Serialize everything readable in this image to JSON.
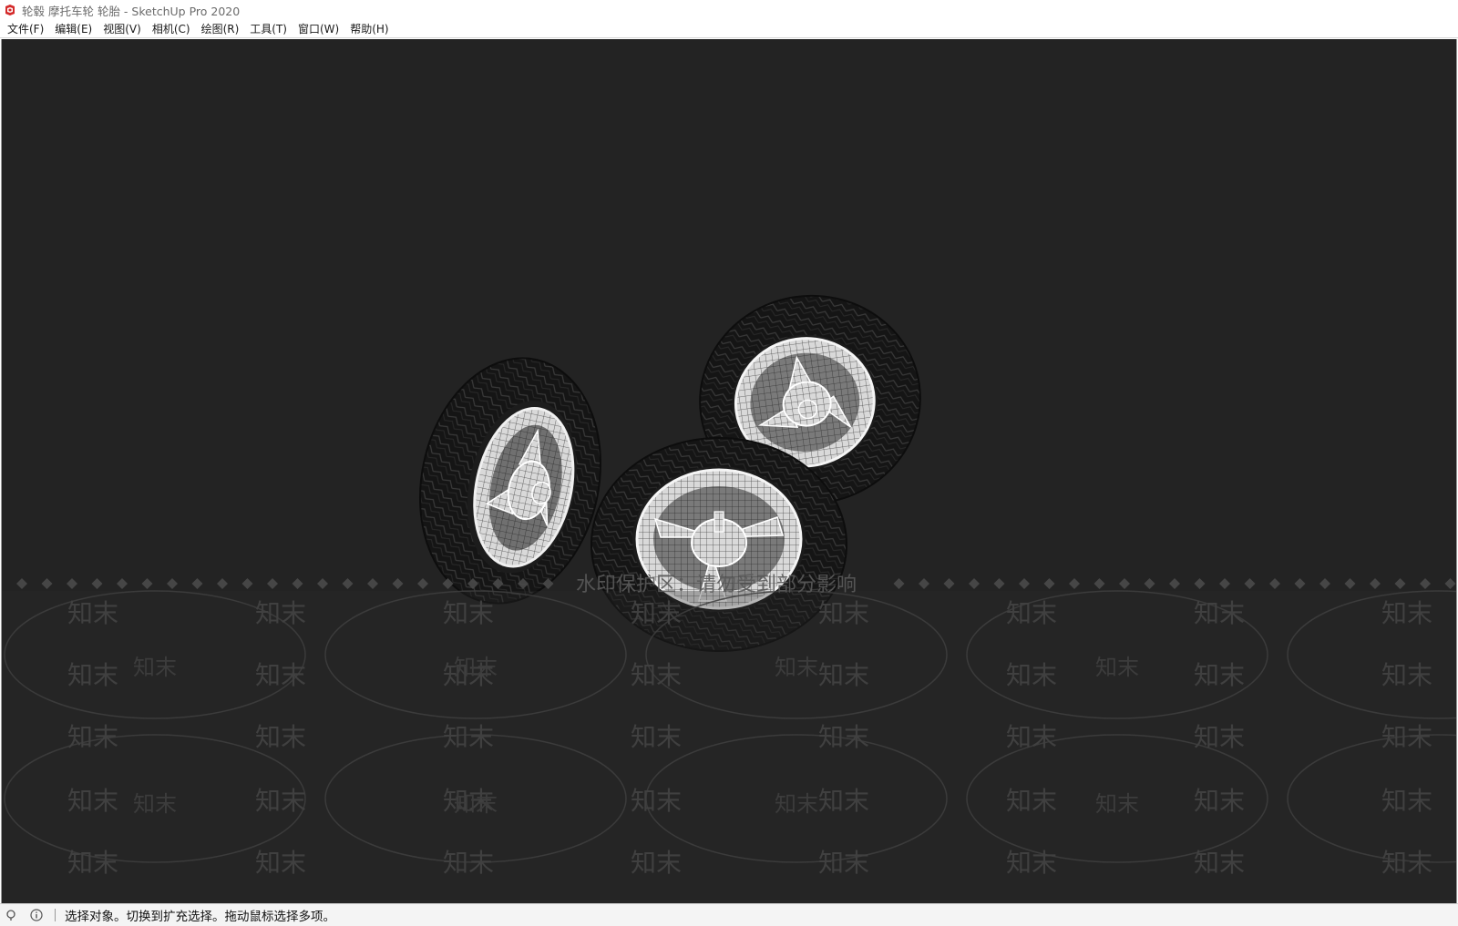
{
  "window": {
    "title": "轮毂 摩托车轮 轮胎 - SketchUp Pro 2020",
    "app_icon": "sketchup-logo-icon"
  },
  "menubar": {
    "items": [
      {
        "label": "文件(F)"
      },
      {
        "label": "编辑(E)"
      },
      {
        "label": "视图(V)"
      },
      {
        "label": "相机(C)"
      },
      {
        "label": "绘图(R)"
      },
      {
        "label": "工具(T)"
      },
      {
        "label": "窗口(W)"
      },
      {
        "label": "帮助(H)"
      }
    ]
  },
  "viewport": {
    "background_color": "#232323",
    "content": "motorcycle-wheels-model",
    "watermark_banner": "水印保护区：请勿受到部分影响",
    "watermark_tile": "知末"
  },
  "statusbar": {
    "icons": [
      "geo-location-icon",
      "info-icon"
    ],
    "message": "选择对象。切换到扩充选择。拖动鼠标选择多项。"
  }
}
